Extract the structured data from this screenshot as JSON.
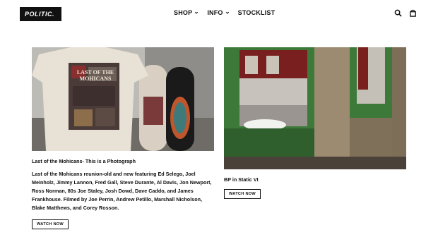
{
  "header": {
    "logo_text": "POLITIC.",
    "nav": [
      {
        "label": "SHOP",
        "dropdown": true
      },
      {
        "label": "INFO",
        "dropdown": true
      },
      {
        "label": "STOCKLIST",
        "dropdown": false
      }
    ],
    "icons": [
      "search-icon",
      "cart-icon"
    ]
  },
  "cards": [
    {
      "title": "Last of the Mohicans- This is a Photograph",
      "description": "Last of the Mohicans reunion-old and new featuring Ed Selego, Joel Meinholz, Jimmy Lannon, Fred Gall, Steve Durante, Al Davis, Jon Newport, Ross Norman, 80s Joe Staley, Josh Dowd, Dave Caddo, and James Frankhouse. Filmed by Joe Perrin, Andrew Petillo, Marshall Nicholson, Blake Matthews, and Corey Rosson.",
      "button_label": "WATCH NOW",
      "image_text": "LAST OF THE MOHICANS"
    },
    {
      "title": "BP in Static VI",
      "description": "",
      "button_label": "WATCH NOW"
    }
  ],
  "colors": {
    "text": "#111111",
    "background": "#ffffff"
  }
}
